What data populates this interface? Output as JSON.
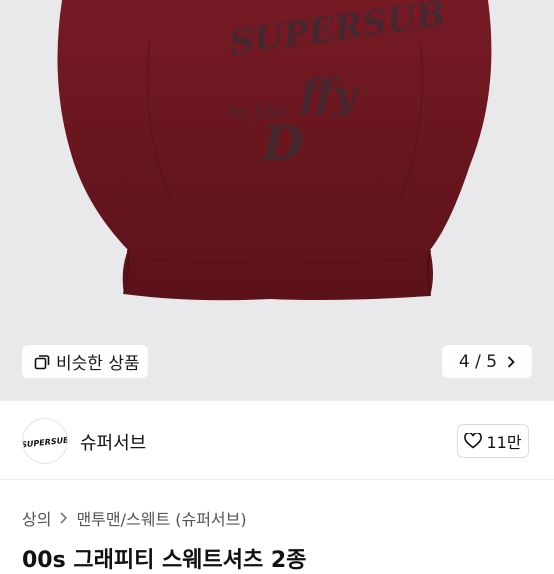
{
  "photo": {
    "print_text": [
      "SUPERSUB",
      "to the",
      "ffy",
      "D"
    ],
    "similar_label": "비슷한 상품",
    "pager": "4 / 5",
    "bg_color": "#e9e9eb",
    "sweater_color": "#6b1620"
  },
  "seller": {
    "logo_text": "SUPERSUB",
    "name": "슈퍼서브",
    "likes": "11만"
  },
  "breadcrumb": {
    "items": [
      "상의",
      "맨투맨/스웨트 (슈퍼서브)"
    ]
  },
  "product": {
    "title": "00s 그래피티 스웨트셔츠 2종"
  }
}
